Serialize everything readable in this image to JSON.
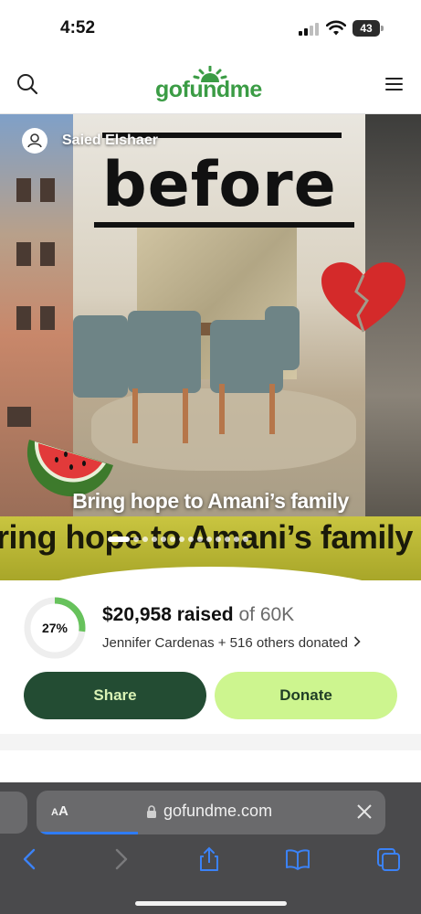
{
  "status_bar": {
    "time": "4:52",
    "battery": "43"
  },
  "header": {
    "logo": "gofundme",
    "brand_color": "#3b9c45",
    "icons": [
      "search-icon",
      "menu-icon"
    ]
  },
  "hero": {
    "author": "Saied Elshaer",
    "overlay_word": "before",
    "caption": "Bring hope to Amani’s family",
    "banner_text": "ring hope to Amani’s family",
    "slides_total": 14,
    "slide_active": 1
  },
  "campaign": {
    "progress_percent_label": "27%",
    "progress_fraction": 0.27,
    "raised_amount": "$20,958 raised",
    "goal_text": "of 60K",
    "donors_text": "Jennifer Cardenas + 516 others donated",
    "share_label": "Share",
    "donate_label": "Donate",
    "share_color": "#234c33",
    "donate_color": "#cdf58f"
  },
  "safari": {
    "text_size_label": "AA",
    "url": "gofundme.com",
    "load_progress": 0.29,
    "accent_color": "#2f7cf6",
    "icons": [
      "back-icon",
      "forward-icon",
      "share-icon",
      "bookmarks-icon",
      "tabs-icon"
    ]
  }
}
